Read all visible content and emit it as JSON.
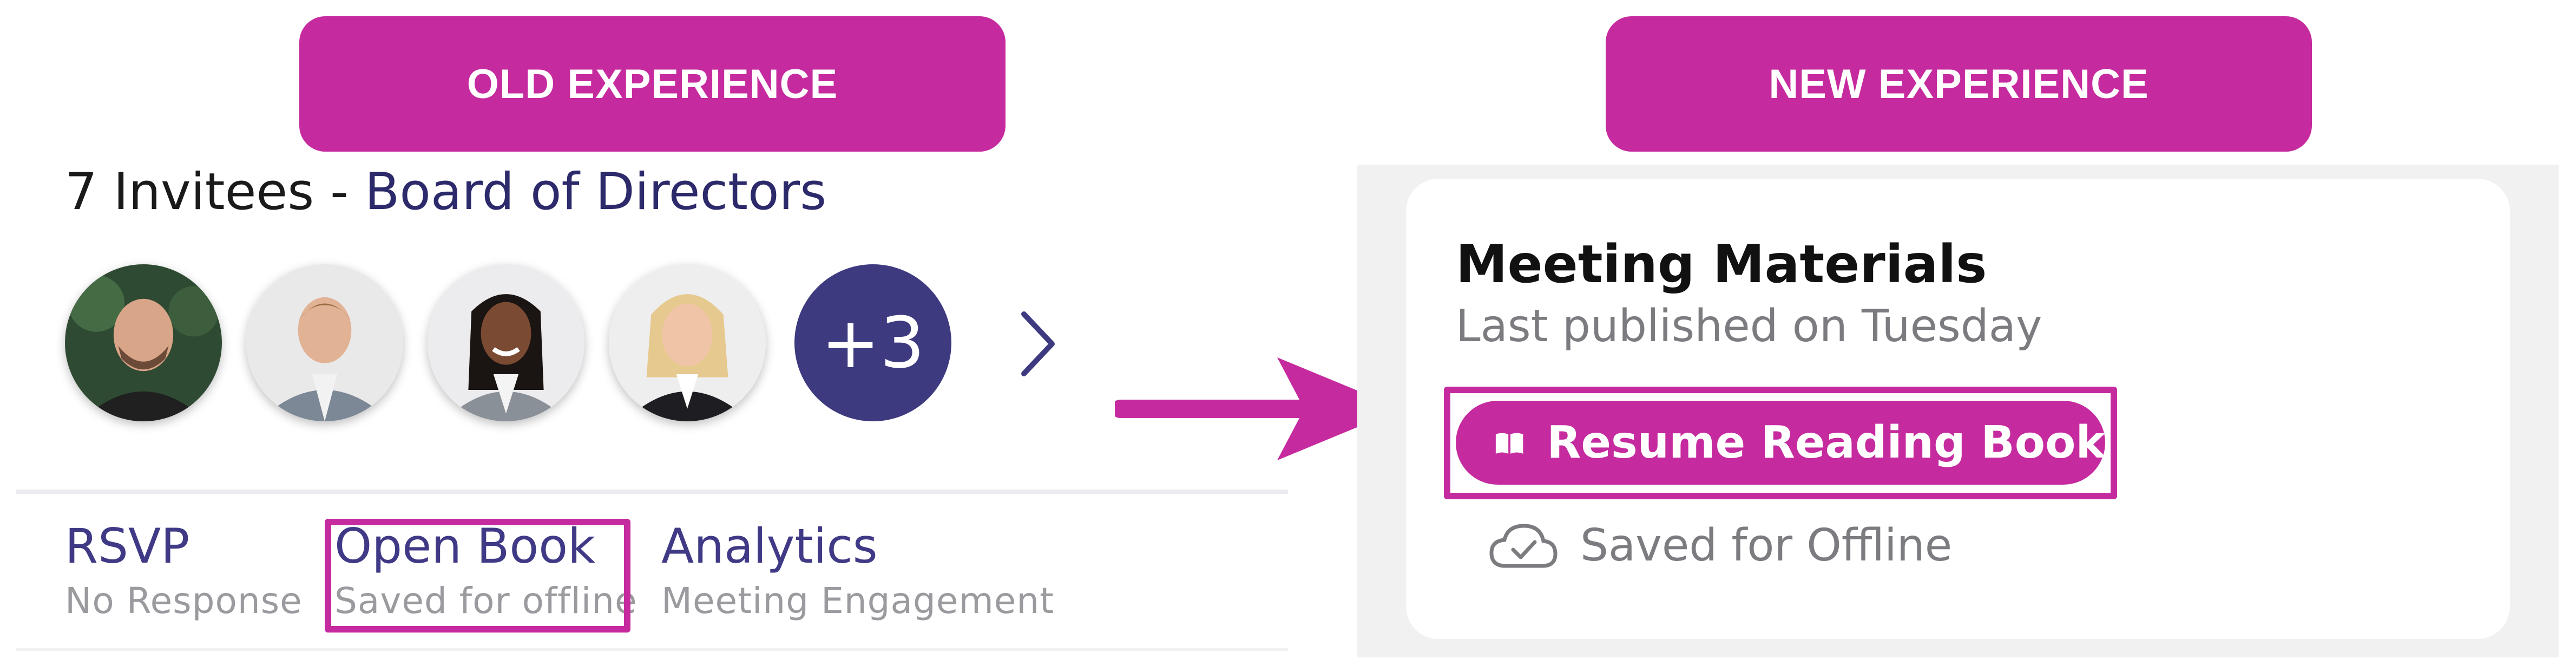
{
  "colors": {
    "accent_magenta": "#c62a9f",
    "navy": "#2c2a6a",
    "more_badge": "#3d3a80",
    "action_text": "#403a86",
    "muted_text": "#9a9a9f"
  },
  "banners": {
    "old_label": "OLD EXPERIENCE",
    "new_label": "NEW EXPERIENCE"
  },
  "old_experience": {
    "invitees_prefix": "7 Invitees - ",
    "invitees_group": "Board of Directors",
    "avatars": [
      {
        "icon": "person-photo-1"
      },
      {
        "icon": "person-photo-2"
      },
      {
        "icon": "person-photo-3"
      },
      {
        "icon": "person-photo-4"
      }
    ],
    "more_count": "+3",
    "chevron_icon": "chevron-right-icon",
    "actions": {
      "rsvp": {
        "label": "RSVP",
        "sub": "No Response"
      },
      "open_book": {
        "label": "Open Book",
        "sub": "Saved for offline"
      },
      "analytics": {
        "label": "Analytics",
        "sub": "Meeting Engagement"
      }
    }
  },
  "new_experience": {
    "card_title": "Meeting Materials",
    "card_subtitle": "Last published on Tuesday",
    "resume_button": {
      "label": "Resume Reading Book",
      "icon": "open-book-icon"
    },
    "offline": {
      "label": "Saved for Offline",
      "icon": "cloud-check-icon"
    }
  }
}
